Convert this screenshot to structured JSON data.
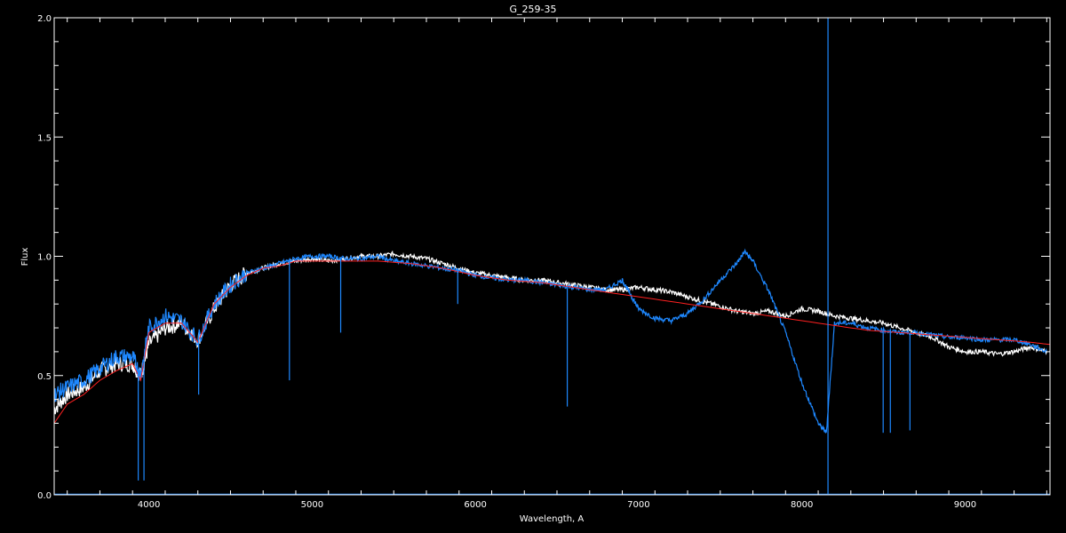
{
  "chart_data": {
    "type": "line",
    "title": "G_259-35",
    "xlabel": "Wavelength, A",
    "ylabel": "Flux",
    "xlim": [
      3420,
      9520
    ],
    "ylim": [
      0.0,
      2.0
    ],
    "x_ticks": [
      4000,
      5000,
      6000,
      7000,
      8000,
      9000
    ],
    "x_tick_labels": [
      "4000",
      "5000",
      "6000",
      "7000",
      "8000",
      "9000"
    ],
    "y_ticks": [
      0.0,
      0.5,
      1.0,
      1.5,
      2.0
    ],
    "y_tick_labels": [
      "0.0",
      "0.5",
      "1.0",
      "1.5",
      "2.0"
    ],
    "grid": false,
    "background": "#000000",
    "axis_color": "#ffffff",
    "series": [
      {
        "color": "#ffffff",
        "x": [
          3420,
          3500,
          3600,
          3700,
          3800,
          3900,
          3950,
          4000,
          4100,
          4200,
          4300,
          4400,
          4500,
          4600,
          4700,
          4800,
          4900,
          5000,
          5100,
          5200,
          5300,
          5400,
          5500,
          5600,
          5700,
          5800,
          5900,
          6000,
          6100,
          6200,
          6300,
          6400,
          6500,
          6600,
          6700,
          6800,
          6900,
          7000,
          7100,
          7200,
          7300,
          7400,
          7500,
          7600,
          7700,
          7800,
          7900,
          8000,
          8100,
          8200,
          8300,
          8400,
          8500,
          8600,
          8700,
          8800,
          8900,
          9000,
          9100,
          9200,
          9300,
          9400,
          9500
        ],
        "y": [
          0.36,
          0.42,
          0.45,
          0.52,
          0.55,
          0.55,
          0.5,
          0.63,
          0.7,
          0.72,
          0.65,
          0.78,
          0.88,
          0.93,
          0.95,
          0.97,
          0.98,
          0.99,
          0.98,
          0.99,
          1.0,
          1.0,
          1.01,
          1.0,
          0.99,
          0.97,
          0.95,
          0.93,
          0.92,
          0.91,
          0.9,
          0.9,
          0.89,
          0.88,
          0.87,
          0.86,
          0.86,
          0.87,
          0.86,
          0.85,
          0.83,
          0.81,
          0.79,
          0.77,
          0.76,
          0.77,
          0.75,
          0.78,
          0.77,
          0.75,
          0.74,
          0.73,
          0.72,
          0.7,
          0.68,
          0.66,
          0.62,
          0.6,
          0.6,
          0.59,
          0.6,
          0.62,
          0.6
        ]
      },
      {
        "color": "#1e88ff",
        "x": [
          3420,
          3500,
          3600,
          3700,
          3800,
          3900,
          3950,
          4000,
          4100,
          4200,
          4300,
          4400,
          4500,
          4600,
          4700,
          4800,
          4900,
          5000,
          5100,
          5200,
          5300,
          5400,
          5500,
          5600,
          5700,
          5800,
          5900,
          6000,
          6100,
          6200,
          6300,
          6400,
          6500,
          6600,
          6700,
          6800,
          6900,
          6950,
          7000,
          7100,
          7200,
          7300,
          7400,
          7500,
          7600,
          7650,
          7700,
          7800,
          7900,
          8000,
          8100,
          8150,
          8200,
          8300,
          8400,
          8500,
          8600,
          8700,
          8800,
          8900,
          9000,
          9100,
          9200,
          9300,
          9400,
          9500
        ],
        "y": [
          0.42,
          0.45,
          0.48,
          0.53,
          0.58,
          0.58,
          0.5,
          0.7,
          0.75,
          0.73,
          0.65,
          0.8,
          0.88,
          0.93,
          0.95,
          0.97,
          0.99,
          1.0,
          1.0,
          0.99,
          0.99,
          1.0,
          0.98,
          0.97,
          0.96,
          0.95,
          0.94,
          0.92,
          0.91,
          0.9,
          0.9,
          0.89,
          0.88,
          0.87,
          0.86,
          0.86,
          0.9,
          0.84,
          0.78,
          0.74,
          0.73,
          0.76,
          0.82,
          0.9,
          0.97,
          1.02,
          0.98,
          0.85,
          0.68,
          0.47,
          0.3,
          0.26,
          0.72,
          0.72,
          0.7,
          0.69,
          0.68,
          0.68,
          0.67,
          0.66,
          0.66,
          0.65,
          0.65,
          0.65,
          0.63,
          0.6
        ]
      },
      {
        "color": "#ff2020",
        "x": [
          3420,
          3500,
          3600,
          3700,
          3800,
          3900,
          3950,
          4000,
          4100,
          4200,
          4300,
          4400,
          4500,
          4600,
          4700,
          4800,
          4900,
          5000,
          5200,
          5400,
          5600,
          5800,
          6000,
          6200,
          6400,
          6600,
          6800,
          7000,
          7200,
          7400,
          7600,
          7800,
          8000,
          8200,
          8400,
          8600,
          8800,
          9000,
          9200,
          9400,
          9520
        ],
        "y": [
          0.3,
          0.38,
          0.42,
          0.48,
          0.52,
          0.55,
          0.48,
          0.68,
          0.72,
          0.72,
          0.64,
          0.8,
          0.87,
          0.92,
          0.95,
          0.96,
          0.98,
          0.98,
          0.98,
          0.98,
          0.97,
          0.95,
          0.92,
          0.9,
          0.89,
          0.87,
          0.85,
          0.83,
          0.81,
          0.79,
          0.77,
          0.75,
          0.73,
          0.71,
          0.69,
          0.68,
          0.67,
          0.66,
          0.65,
          0.64,
          0.63
        ]
      }
    ],
    "absorption_lines_blue": [
      {
        "x": 3935,
        "depth_to": 0.06
      },
      {
        "x": 3970,
        "depth_to": 0.06
      },
      {
        "x": 4305,
        "depth_to": 0.42
      },
      {
        "x": 4861,
        "depth_to": 0.48
      },
      {
        "x": 5175,
        "depth_to": 0.68
      },
      {
        "x": 5892,
        "depth_to": 0.8
      },
      {
        "x": 6563,
        "depth_to": 0.37
      },
      {
        "x": 8498,
        "depth_to": 0.26
      },
      {
        "x": 8542,
        "depth_to": 0.26
      },
      {
        "x": 8662,
        "depth_to": 0.27
      }
    ],
    "vertical_spike_x": 8160
  }
}
